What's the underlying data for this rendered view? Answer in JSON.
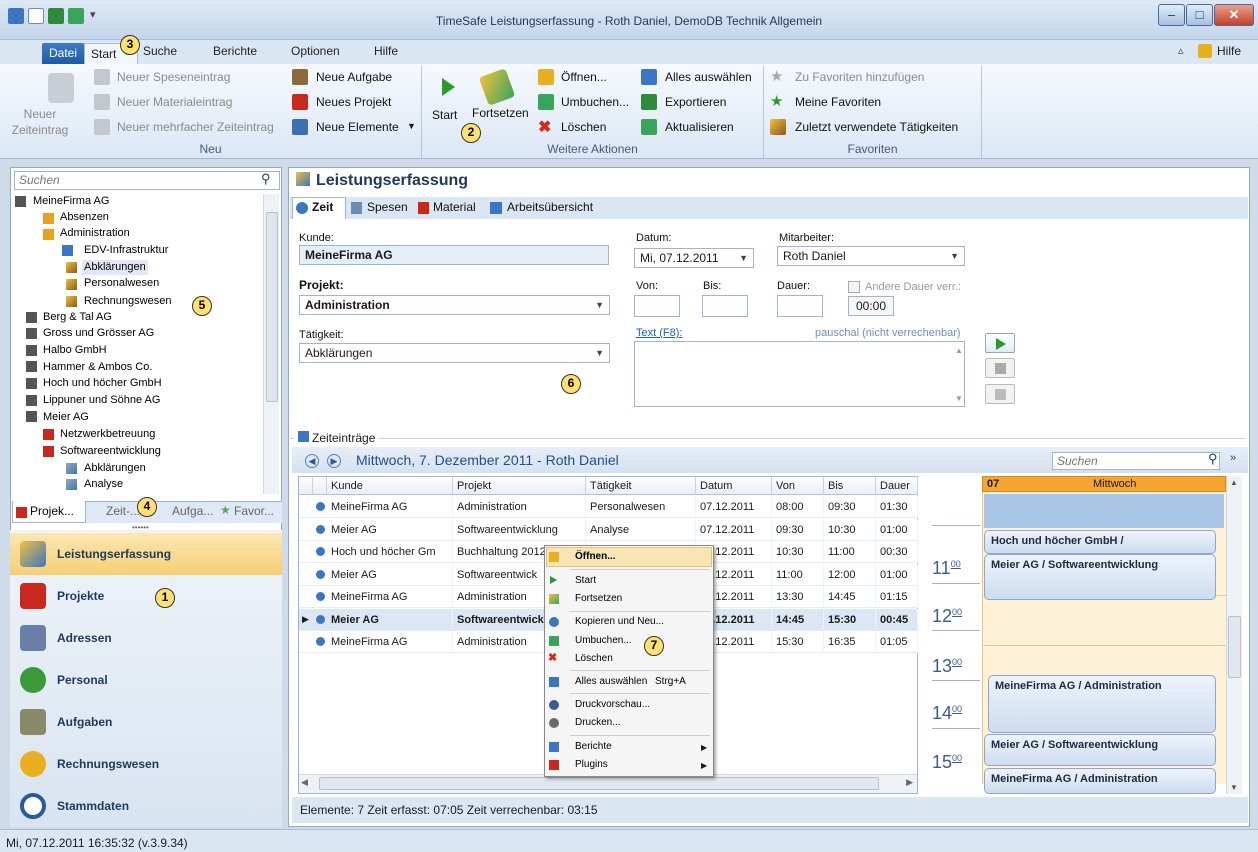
{
  "window": {
    "title": "TimeSafe Leistungserfassung - Roth Daniel, DemoDB Technik Allgemein",
    "help": "Hilfe"
  },
  "ribbon_tabs": [
    "Datei",
    "Start",
    "Suche",
    "Berichte",
    "Optionen",
    "Hilfe"
  ],
  "ribbon": {
    "neu_big": "Neuer Zeiteintrag",
    "neu_items": [
      "Neuer Speseneintrag",
      "Neuer Materialeintrag",
      "Neuer mehrfacher Zeiteintrag"
    ],
    "neu2_items": [
      "Neue Aufgabe",
      "Neues Projekt",
      "Neue Elemente"
    ],
    "neu_label": "Neu",
    "start": "Start",
    "fortsetzen": "Fortsetzen",
    "weitere_items": [
      "Öffnen...",
      "Umbuchen...",
      "Löschen"
    ],
    "weitere2_items": [
      "Alles auswählen",
      "Exportieren",
      "Aktualisieren"
    ],
    "weitere_label": "Weitere Aktionen",
    "fav_items": [
      "Zu Favoriten hinzufügen",
      "Meine Favoriten",
      "Zuletzt verwendete Tätigkeiten"
    ],
    "fav_label": "Favoriten"
  },
  "left": {
    "search_placeholder": "Suchen",
    "tree": [
      "MeineFirma AG",
      "Absenzen",
      "Administration",
      "EDV-Infrastruktur",
      "Abklärungen",
      "Personalwesen",
      "Rechnungswesen",
      "Berg & Tal AG",
      "Gross und Grösser AG",
      "Halbo GmbH",
      "Hammer & Ambos Co.",
      "Hoch und höcher GmbH",
      "Lippuner und Söhne AG",
      "Meier AG",
      "Netzwerkbetreuung",
      "Softwareentwicklung",
      "Abklärungen",
      "Analyse"
    ],
    "tabs": [
      "Projek...",
      "Zeit-...",
      "Aufga...",
      "Favor..."
    ],
    "nav": [
      "Leistungserfassung",
      "Projekte",
      "Adressen",
      "Personal",
      "Aufgaben",
      "Rechnungswesen",
      "Stammdaten"
    ]
  },
  "status": "Mi, 07.12.2011 16:35:32 (v.3.9.34)",
  "form": {
    "title": "Leistungserfassung",
    "tabs": [
      "Zeit",
      "Spesen",
      "Material",
      "Arbeitsübersicht"
    ],
    "kunde_label": "Kunde:",
    "kunde": "MeineFirma AG",
    "datum_label": "Datum:",
    "datum": "Mi, 07.12.2011",
    "mitarbeiter_label": "Mitarbeiter:",
    "mitarbeiter": "Roth Daniel",
    "projekt_label": "Projekt:",
    "projekt": "Administration",
    "von_label": "Von:",
    "bis_label": "Bis:",
    "dauer_label": "Dauer:",
    "andere_label": "Andere Dauer verr.:",
    "andere_value": "00:00",
    "taetigkeit_label": "Tätigkeit:",
    "taetigkeit": "Abklärungen",
    "text_label": "Text (F8):",
    "pauschal": "pauschal (nicht verrechenbar)"
  },
  "grid": {
    "section": "Zeiteinträge",
    "day_title": "Mittwoch, 7. Dezember 2011 - Roth Daniel",
    "search_placeholder": "Suchen",
    "columns": [
      "Kunde",
      "Projekt",
      "Tätigkeit",
      "Datum",
      "Von",
      "Bis",
      "Dauer"
    ],
    "rows": [
      [
        "MeineFirma AG",
        "Administration",
        "Personalwesen",
        "07.12.2011",
        "08:00",
        "09:30",
        "01:30"
      ],
      [
        "Meier AG",
        "Softwareentwicklung",
        "Analyse",
        "07.12.2011",
        "09:30",
        "10:30",
        "01:00"
      ],
      [
        "Hoch und höcher Gm",
        "Buchhaltung 2012",
        "",
        "07.12.2011",
        "10:30",
        "11:00",
        "00:30"
      ],
      [
        "Meier AG",
        "Softwareentwick",
        "",
        "07.12.2011",
        "11:00",
        "12:00",
        "01:00"
      ],
      [
        "MeineFirma AG",
        "Administration",
        "",
        "07.12.2011",
        "13:30",
        "14:45",
        "01:15"
      ],
      [
        "Meier AG",
        "Softwareentwick",
        "",
        "07.12.2011",
        "14:45",
        "15:30",
        "00:45"
      ],
      [
        "MeineFirma AG",
        "Administration",
        "",
        "07.12.2011",
        "15:30",
        "16:35",
        "01:05"
      ]
    ],
    "footer": "Elemente: 7   Zeit erfasst: 07:05   Zeit verrechenbar: 03:15"
  },
  "calendar": {
    "day_num": "07",
    "day_name": "Mittwoch",
    "hours": [
      "11",
      "12",
      "13",
      "14",
      "15"
    ],
    "minutes": "00",
    "appointments": [
      "Hoch und höcher GmbH /",
      "Meier AG / Softwareentwicklung",
      "MeineFirma AG / Administration",
      "Meier AG / Softwareentwicklung",
      "MeineFirma AG / Administration"
    ]
  },
  "context_menu": [
    "Öffnen...",
    "Start",
    "Fortsetzen",
    "Kopieren und Neu...",
    "Umbuchen...",
    "Löschen",
    "Alles auswählen",
    "Strg+A",
    "Druckvorschau...",
    "Drucken...",
    "Berichte",
    "Plugins"
  ],
  "badges": [
    "1",
    "2",
    "3",
    "4",
    "5",
    "6",
    "7"
  ]
}
